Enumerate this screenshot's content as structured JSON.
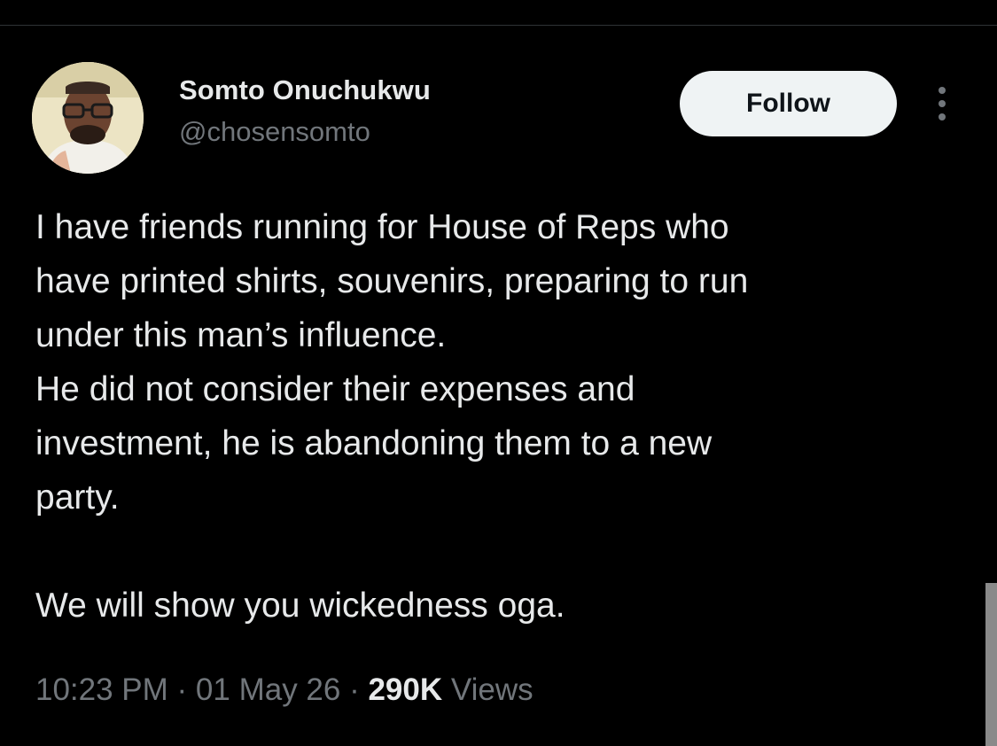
{
  "author": {
    "name": "Somto Onuchukwu",
    "handle": "@chosensomto",
    "avatar_icon": "profile-photo"
  },
  "actions": {
    "follow_label": "Follow",
    "more_icon": "more-vertical-icon"
  },
  "tweet": {
    "lines": [
      "I have friends running for House of Reps who",
      "have printed shirts, souvenirs, preparing to run",
      "under this man’s influence.",
      "He did not consider their expenses and",
      "investment, he is abandoning them to a new",
      "party."
    ],
    "closing_line": "We will show you wickedness oga."
  },
  "meta": {
    "time": "10:23 PM",
    "separator": " · ",
    "date": "01 May 26",
    "views_count": "290K",
    "views_label": " Views"
  },
  "colors": {
    "background": "#000000",
    "primary_text": "#e7e9ea",
    "secondary_text": "#71767b",
    "follow_bg": "#eff3f4",
    "follow_text": "#0f1419"
  }
}
